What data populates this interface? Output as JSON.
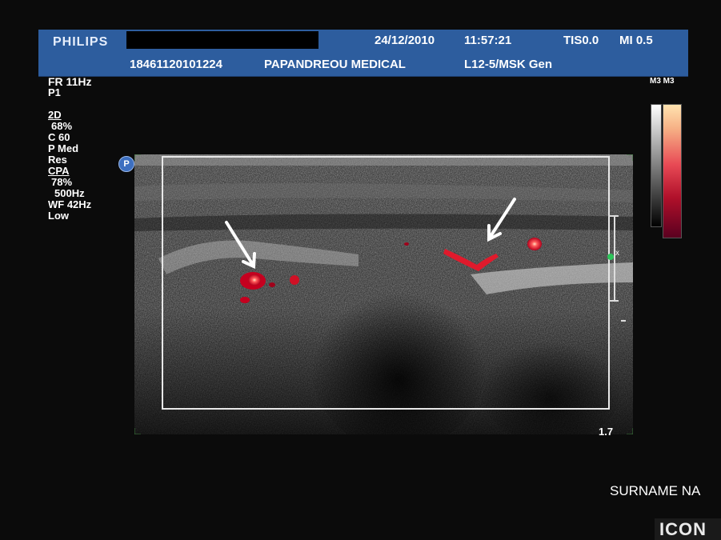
{
  "header": {
    "brand": "PHILIPS",
    "patient_id": "18461120101224",
    "institution": "PAPANDREOU MEDICAL",
    "date": "24/12/2010",
    "time": "11:57:21",
    "tis": "TIS0.0",
    "mi": "MI 0.5",
    "probe": "L12-5/MSK Gen"
  },
  "params": {
    "fr": "FR 11Hz",
    "preset": "P1",
    "mode_2d": "2D",
    "gain_2d": "68%",
    "c": "C 60",
    "p": "P Med",
    "res": "Res",
    "mode_cpa": "CPA",
    "gain_cpa": "78%",
    "prf": "500Hz",
    "wf": "WF 42Hz",
    "wf_level": "Low"
  },
  "colormap_label": "M3 M3",
  "probe_marker": "P",
  "scale_marker": "x",
  "depth": "1.7",
  "surname_text": "SURNAME NA",
  "badge": "ICON",
  "colors": {
    "header_blue": "#2d5d9e",
    "doppler_red": "#e01a2c",
    "background": "#0b0b0b"
  }
}
